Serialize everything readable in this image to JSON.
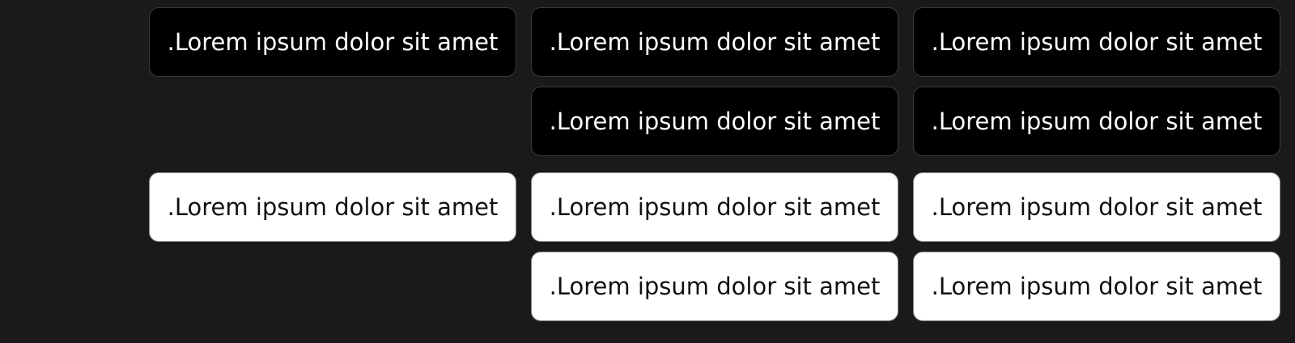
{
  "buttons": {
    "dark_row1": [
      ".Lorem ipsum dolor sit amet",
      ".Lorem ipsum dolor sit amet",
      ".Lorem ipsum dolor sit amet"
    ],
    "dark_row2": [
      ".Lorem ipsum dolor sit amet",
      ".Lorem ipsum dolor sit amet"
    ],
    "light_row1": [
      ".Lorem ipsum dolor sit amet",
      ".Lorem ipsum dolor sit amet",
      ".Lorem ipsum dolor sit amet"
    ],
    "light_row2": [
      ".Lorem ipsum dolor sit amet",
      ".Lorem ipsum dolor sit amet"
    ]
  },
  "colors": {
    "background": "#1a1a1a",
    "dark_button_bg": "#000000",
    "dark_button_text": "#ffffff",
    "light_button_bg": "#ffffff",
    "light_button_text": "#111111"
  }
}
